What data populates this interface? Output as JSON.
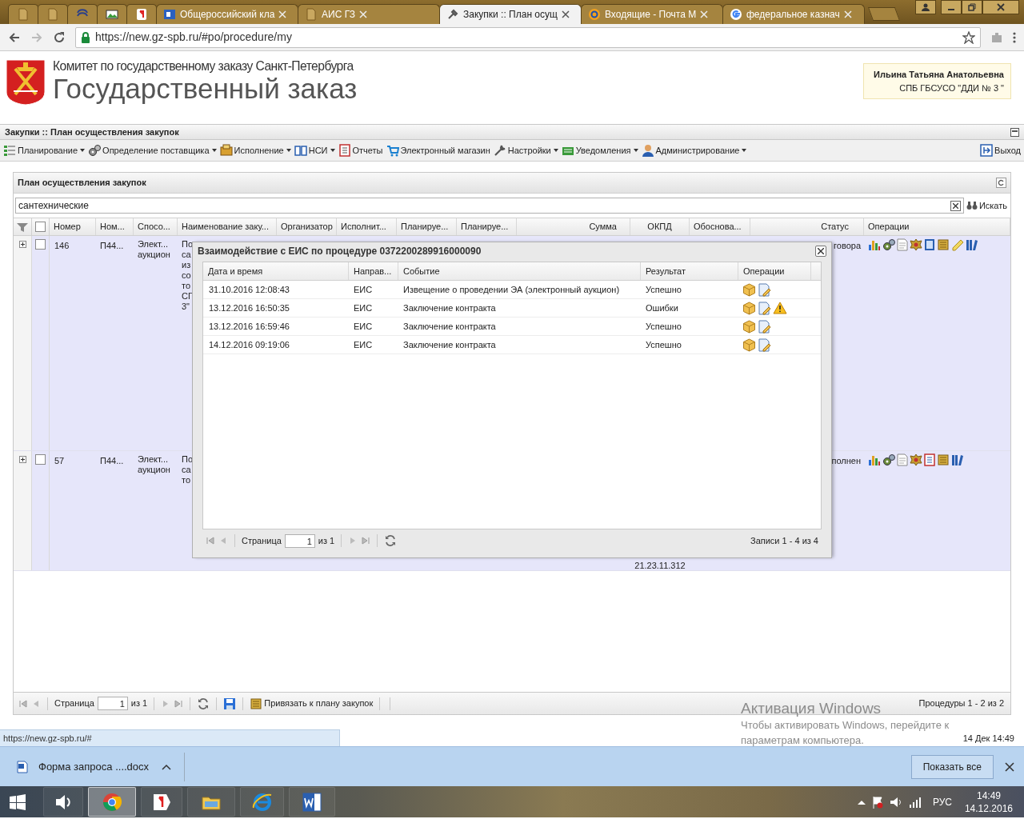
{
  "browser": {
    "tabs": [
      {
        "kind": "pinned",
        "selected": false
      },
      {
        "kind": "pinned",
        "selected": false
      },
      {
        "kind": "pinned",
        "selected": false
      },
      {
        "kind": "pinned",
        "selected": false
      },
      {
        "kind": "pinned",
        "selected": false
      },
      {
        "kind": "page",
        "title": "Общероссийский кла",
        "selected": false
      },
      {
        "kind": "page",
        "title": "АИС ГЗ",
        "selected": false
      },
      {
        "kind": "page",
        "title": "Закупки :: План осущ",
        "selected": true
      },
      {
        "kind": "page",
        "title": "Входящие - Почта М",
        "selected": false
      },
      {
        "kind": "page",
        "title": "федеральное казнач",
        "selected": false
      }
    ],
    "url": "https://new.gz-spb.ru/#po/procedure/my"
  },
  "header": {
    "subtitle": "Комитет по государственному заказу Санкт-Петербурга",
    "title": "Государственный заказ",
    "user": {
      "name": "Ильина Татьяна Анатольевна",
      "org": "СПБ ГБСУСО \"ДДИ № 3 \""
    }
  },
  "module_title": "Закупки :: План осуществления закупок",
  "menu": [
    {
      "label": "Планирование",
      "dropdown": true
    },
    {
      "label": "Определение поставщика",
      "dropdown": true
    },
    {
      "label": "Исполнение",
      "dropdown": true
    },
    {
      "label": "НСИ",
      "dropdown": true
    },
    {
      "label": "Отчеты",
      "dropdown": false
    },
    {
      "label": "Электронный магазин",
      "dropdown": false
    },
    {
      "label": "Настройки",
      "dropdown": true
    },
    {
      "label": "Уведомления",
      "dropdown": true
    },
    {
      "label": "Администрирование",
      "dropdown": true
    }
  ],
  "exit": "Выход",
  "panel": {
    "title": "План осуществления закупок",
    "search": {
      "value": "сантехнические",
      "button": "Искать"
    },
    "select_all": {
      "checked": false
    },
    "columns": [
      "Номер",
      "Ном...",
      "Спосо...",
      "Наименование заку...",
      "Организатор",
      "Исполнит...",
      "Планируе...",
      "Планируе...",
      "Сумма",
      "ОКПД",
      "Обоснова...",
      "Статус",
      "Операции"
    ],
    "rows": [
      {
        "expanded": false,
        "checked": false,
        "number": "146",
        "column_2": "П44...",
        "method": "Элект... аукцион",
        "name_visible": [
          "По",
          "са",
          "из",
          "со",
          "то",
          "СГ",
          "3\""
        ],
        "okpd": "",
        "status": "говора"
      },
      {
        "expanded": false,
        "checked": false,
        "number": "57",
        "column_2": "П44...",
        "method": "Элект... аукцион",
        "name_visible": [
          "По",
          "са",
          "то"
        ],
        "okpd": "21.23.11.312",
        "status": "полнен"
      }
    ],
    "pager": {
      "page_label": "Страница",
      "page": "1",
      "of": "из 1",
      "bind_button": "Привязать к плану закупок",
      "summary": "Процедуры 1 - 2 из 2"
    }
  },
  "dialog": {
    "title": "Взаимодействие с ЕИС по процедуре 0372200289916000090",
    "columns": [
      "Дата и время",
      "Направ...",
      "Событие",
      "Результат",
      "Операции"
    ],
    "rows": [
      {
        "datetime": "31.10.2016 12:08:43",
        "direction": "ЕИС",
        "event": "Извещение о проведении ЭА (электронный аукцион)",
        "result": "Успешно",
        "warning": false
      },
      {
        "datetime": "13.12.2016 16:50:35",
        "direction": "ЕИС",
        "event": "Заключение контракта",
        "result": "Ошибки",
        "warning": true
      },
      {
        "datetime": "13.12.2016 16:59:46",
        "direction": "ЕИС",
        "event": "Заключение контракта",
        "result": "Успешно",
        "warning": false
      },
      {
        "datetime": "14.12.2016 09:19:06",
        "direction": "ЕИС",
        "event": "Заключение контракта",
        "result": "Успешно",
        "warning": false
      }
    ],
    "pager": {
      "page_label": "Страница",
      "page": "1",
      "of": "из 1",
      "summary": "Записи 1 - 4 из 4"
    }
  },
  "windows_activation": {
    "title": "Активация Windows",
    "text": "Чтобы активировать Windows, перейдите к параметрам компьютера."
  },
  "status_bar": {
    "url": "https://new.gz-spb.ru/#",
    "time": "14 Дек 14:49"
  },
  "downloads": {
    "file": "Форма запроса ....docx",
    "show_all": "Показать все"
  },
  "taskbar": {
    "apps": [
      {
        "kind": "sound",
        "selected": false
      },
      {
        "kind": "chrome",
        "selected": true
      },
      {
        "kind": "yandex",
        "selected": false
      },
      {
        "kind": "folder",
        "selected": false
      },
      {
        "kind": "ie",
        "selected": false
      },
      {
        "kind": "word",
        "selected": false
      }
    ],
    "language": "РУС",
    "time": "14:49",
    "date": "14.12.2016"
  }
}
